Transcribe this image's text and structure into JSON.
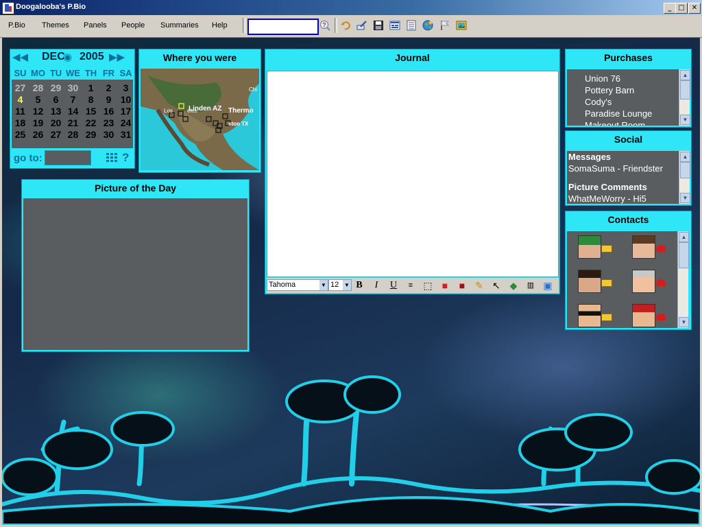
{
  "window": {
    "title": "Doogalooba's P.Bio",
    "minimize_label": "_",
    "maximize_label": "□",
    "close_label": "✕"
  },
  "menu": [
    "P.Bio",
    "Themes",
    "Panels",
    "People",
    "Summaries",
    "Help"
  ],
  "toolbar": {
    "search_value": "",
    "icons": [
      "search-help-icon",
      "undo-icon",
      "edit-icon",
      "save-icon",
      "layout-icon",
      "calendar-icon",
      "globe-icon",
      "flag-icon",
      "picture-icon"
    ]
  },
  "calendar": {
    "prev_label": "◀◀",
    "month": "DEC",
    "center_icon": "◉",
    "year": "2005",
    "next_label": "▶▶",
    "dow": [
      "SU",
      "MO",
      "TU",
      "WE",
      "TH",
      "FR",
      "SA"
    ],
    "weeks": [
      [
        "27",
        "28",
        "29",
        "30",
        "1",
        "2",
        "3"
      ],
      [
        "4",
        "5",
        "6",
        "7",
        "8",
        "9",
        "10"
      ],
      [
        "11",
        "12",
        "13",
        "14",
        "15",
        "16",
        "17"
      ],
      [
        "18",
        "19",
        "20",
        "21",
        "22",
        "23",
        "24"
      ],
      [
        "25",
        "26",
        "27",
        "28",
        "29",
        "30",
        "31"
      ]
    ],
    "other_month_days": [
      "27",
      "28",
      "29",
      "30"
    ],
    "today": "4",
    "goto_label": "go to:",
    "help_label": "?"
  },
  "map": {
    "title": "Where you were",
    "labels": [
      "Linden AZ",
      "Thermo",
      "Los",
      "eles",
      "ston TX",
      "Chi"
    ]
  },
  "picture": {
    "title": "Picture of the Day"
  },
  "journal": {
    "title": "Journal",
    "font": "Tahoma",
    "size": "12",
    "bold_label": "B",
    "italic_label": "I",
    "underline_label": "U"
  },
  "purchases": {
    "title": "Purchases",
    "items": [
      "Union 76",
      "Pottery Barn",
      "Cody's",
      "Paradise Lounge",
      "Makeout Room"
    ]
  },
  "social": {
    "title": "Social",
    "messages_heading": "Messages",
    "messages": [
      "SomaSuma - Friendster"
    ],
    "comments_heading": "Picture Comments",
    "comments": [
      "WhatMeWorry - Hi5"
    ]
  },
  "contacts": {
    "title": "Contacts"
  },
  "colors": {
    "panel": "#2ee6f5",
    "panel_body": "#5a5d60",
    "today": "#ffff33",
    "accent": "#0a6f9c"
  }
}
